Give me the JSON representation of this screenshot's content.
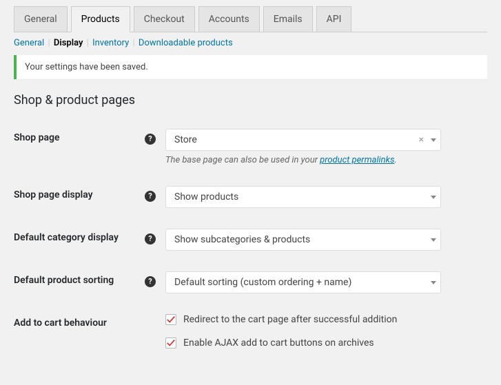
{
  "tabs": {
    "general": "General",
    "products": "Products",
    "checkout": "Checkout",
    "accounts": "Accounts",
    "emails": "Emails",
    "api": "API"
  },
  "subtabs": {
    "general": "General",
    "display": "Display",
    "inventory": "Inventory",
    "downloadable": "Downloadable products"
  },
  "notice": "Your settings have been saved.",
  "section_title": "Shop & product pages",
  "labels": {
    "shop_page": "Shop page",
    "shop_page_display": "Shop page display",
    "default_category_display": "Default category display",
    "default_product_sorting": "Default product sorting",
    "add_to_cart_behaviour": "Add to cart behaviour"
  },
  "values": {
    "shop_page": "Store",
    "shop_page_display": "Show products",
    "default_category_display": "Show subcategories & products",
    "default_product_sorting": "Default sorting (custom ordering + name)"
  },
  "description": {
    "shop_page_prefix": "The base page can also be used in your ",
    "shop_page_link": "product permalinks",
    "shop_page_suffix": "."
  },
  "checkboxes": {
    "redirect": "Redirect to the cart page after successful addition",
    "ajax": "Enable AJAX add to cart buttons on archives"
  }
}
